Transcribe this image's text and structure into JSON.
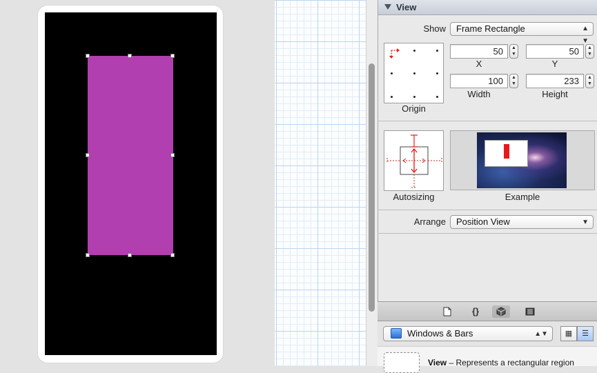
{
  "inspector": {
    "section_title": "View",
    "show_label": "Show",
    "show_value": "Frame Rectangle",
    "x_value": "50",
    "y_value": "50",
    "width_value": "100",
    "height_value": "233",
    "x_label": "X",
    "y_label": "Y",
    "width_label": "Width",
    "height_label": "Height",
    "origin_label": "Origin",
    "autosizing_label": "Autosizing",
    "example_label": "Example",
    "arrange_label": "Arrange",
    "arrange_value": "Position View"
  },
  "toolbar": {
    "icons": [
      "file-icon",
      "braces-icon",
      "cube-icon",
      "media-icon"
    ],
    "braces_glyph": "{}"
  },
  "library": {
    "filter_value": "Windows & Bars",
    "item_title": "View",
    "item_description": " – Represents a rectangular region"
  },
  "colors": {
    "subview": "#b13fb0",
    "screen": "#000000",
    "autosizing_strut": "#e0221e"
  }
}
